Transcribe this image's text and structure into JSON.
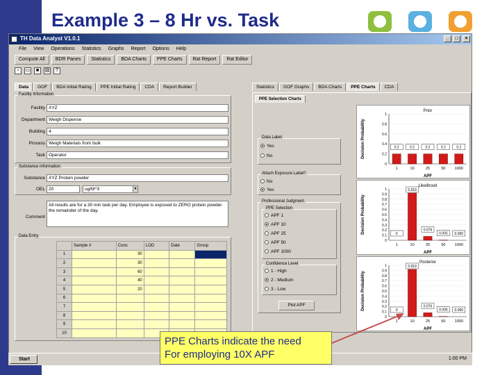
{
  "slide": {
    "title": "Example 3 – 8 Hr vs. Task",
    "callout_line1": "PPE Charts indicate the need",
    "callout_line2": "For employing 10X APF"
  },
  "colors": {
    "accent_blue": "#2d3a8c",
    "deco_green": "#8fbf3f",
    "deco_blue": "#5ab0e0",
    "deco_orange": "#f0a030",
    "bar_red": "#d21a1a",
    "callout_bg": "#ffff66"
  },
  "app": {
    "title": "TH Data Analyst V1.0.1",
    "menu": [
      "File",
      "View",
      "Operations",
      "Statistics",
      "Graphs",
      "Report",
      "Options",
      "Help"
    ],
    "toolbar": [
      "Compute All",
      "BDR Panes",
      "Statistics",
      "BDA Charts",
      "PPE Charts",
      "Rat Report",
      "Rat Editor"
    ],
    "toolbar_icons": [
      "new-icon",
      "open-icon",
      "save-icon",
      "print-icon",
      "help-icon"
    ],
    "left_tabs": [
      "Data",
      "GOF",
      "BDA Initial Rating",
      "PPE Initial Rating",
      "CDA",
      "Report Builder"
    ],
    "right_tabs": [
      "Statistics",
      "GOF Graphs",
      "BDA Charts",
      "PPE Charts",
      "CDA"
    ],
    "facility": {
      "group": "Facility Information",
      "facility_label": "Facility",
      "facility_value": "XYZ",
      "department_label": "Department",
      "department_value": "Weigh Dispense",
      "building_label": "Building",
      "building_value": "4",
      "process_label": "Process",
      "process_value": "Weigh Materials from bulk",
      "task_label": "Task",
      "task_value": "Operator"
    },
    "substance": {
      "group": "Substance Information",
      "substance_label": "Substance",
      "substance_value": "XYZ Protein powder",
      "oel_label": "OEL",
      "oel_value": "20",
      "oel_units": "ug/M^3"
    },
    "comment": {
      "label": "Comment",
      "value": "All results are for a 30 min task per day. Employee is exposed to ZERO protein powder the remainder of the day."
    },
    "data_entry": {
      "group": "Data Entry",
      "columns": [
        "",
        "Sample #",
        "Conc",
        "LOD",
        "Date",
        "Group"
      ],
      "rows": [
        [
          "1",
          "",
          "30",
          "",
          "",
          ""
        ],
        [
          "2",
          "",
          "30",
          "",
          "",
          ""
        ],
        [
          "3",
          "",
          "60",
          "",
          "",
          ""
        ],
        [
          "4",
          "",
          "40",
          "",
          "",
          ""
        ],
        [
          "5",
          "",
          "20",
          "",
          "",
          ""
        ],
        [
          "6",
          "",
          "",
          "",
          "",
          ""
        ],
        [
          "7",
          "",
          "",
          "",
          "",
          ""
        ],
        [
          "8",
          "",
          "",
          "",
          "",
          ""
        ],
        [
          "9",
          "",
          "",
          "",
          "",
          ""
        ],
        [
          "10",
          "",
          "",
          "",
          "",
          ""
        ]
      ]
    },
    "ppe_tab": "PPE Selection Charts",
    "data_label": {
      "group": "Data Label",
      "options": [
        "Yes",
        "No"
      ],
      "selected": "Yes"
    },
    "attach_label": {
      "group": "Attach Exposure Label?",
      "options": [
        "No",
        "Yes"
      ],
      "selected": "Yes"
    },
    "prof_judgment": {
      "group": "Professional Judgment",
      "ppe_group": "PPE Selection",
      "ppe_options": [
        "APF 1",
        "APF 10",
        "APF 25",
        "APF 50",
        "APF 1000"
      ],
      "ppe_selected": "APF 10",
      "conf_group": "Confidence Level",
      "conf_options": [
        "1 - High",
        "2 - Medium",
        "3 - Low"
      ],
      "conf_selected": "2 - Medium",
      "plot_button": "Plot APF"
    },
    "charts": [
      {
        "title": "Prior",
        "ylabel": "Decision Probability",
        "xlabel": "APF"
      },
      {
        "title": "Likelihood",
        "ylabel": "Decision Probability",
        "xlabel": "APF"
      },
      {
        "title": "Posterior",
        "ylabel": "Decision Probability",
        "xlabel": "APF"
      }
    ],
    "taskbar": {
      "start": "Start",
      "clock": "1:00 PM"
    }
  },
  "chart_data": [
    {
      "type": "bar",
      "title": "Prior",
      "ylabel": "Decision Probability",
      "xlabel": "APF",
      "categories": [
        "1",
        "10",
        "25",
        "50",
        "1000"
      ],
      "values": [
        0.2,
        0.2,
        0.2,
        0.2,
        0.2
      ],
      "data_labels": [
        "0.2",
        "0.2",
        "0.2",
        "0.2",
        "0.2"
      ],
      "ylim": [
        0,
        1
      ],
      "yticks": [
        "0",
        "0.2",
        "0.4",
        "0.6",
        "0.8",
        "1"
      ]
    },
    {
      "type": "bar",
      "title": "Likelihood",
      "ylabel": "Decision Probability",
      "xlabel": "APF",
      "categories": [
        "1",
        "10",
        "25",
        "50",
        "1000"
      ],
      "values": [
        0.0,
        0.919,
        0.076,
        0.005,
        0.0
      ],
      "data_labels": [
        "0",
        "0.919",
        "0.076",
        "0.005",
        "0.000"
      ],
      "ylim": [
        0,
        1
      ],
      "yticks": [
        "0",
        "0.1",
        "0.2",
        "0.3",
        "0.4",
        "0.5",
        "0.6",
        "0.7",
        "0.8",
        "0.9",
        "1"
      ]
    },
    {
      "type": "bar",
      "title": "Posterior",
      "ylabel": "Decision Probability",
      "xlabel": "APF",
      "categories": [
        "1",
        "10",
        "25",
        "50",
        "1000"
      ],
      "values": [
        0.0,
        0.919,
        0.076,
        0.005,
        0.0
      ],
      "data_labels": [
        "0",
        "0.919",
        "0.076",
        "0.005",
        "0.000"
      ],
      "ylim": [
        0,
        1
      ],
      "yticks": [
        "0",
        "0.1",
        "0.2",
        "0.3",
        "0.4",
        "0.5",
        "0.6",
        "0.7",
        "0.8",
        "0.9",
        "1"
      ]
    }
  ]
}
